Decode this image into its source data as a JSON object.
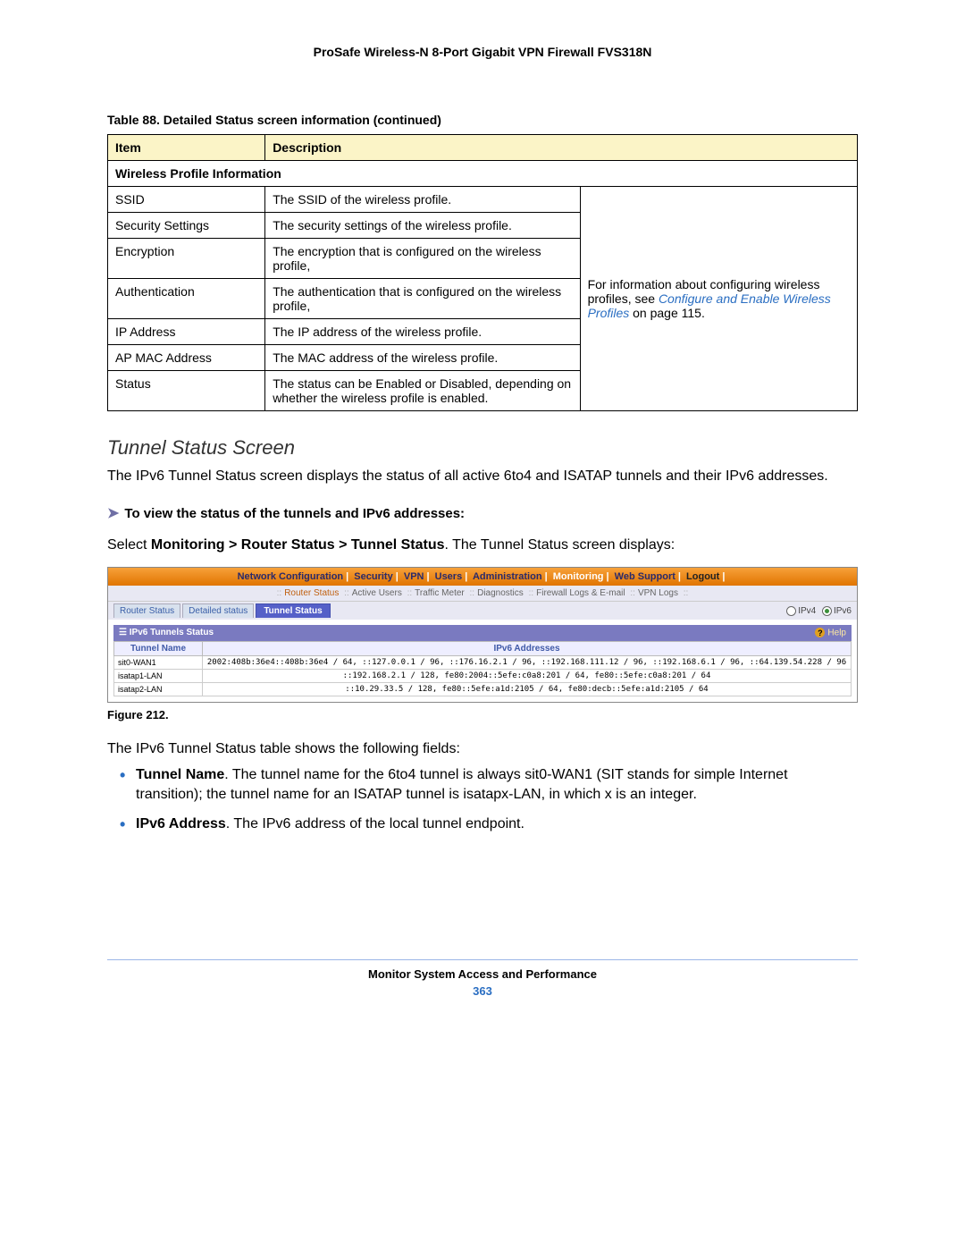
{
  "doc_title": "ProSafe Wireless-N 8-Port Gigabit VPN Firewall FVS318N",
  "table_caption": "Table 88.  Detailed Status screen information (continued)",
  "headers": {
    "item": "Item",
    "description": "Description"
  },
  "section_row": "Wireless Profile Information",
  "rows": [
    {
      "item": "SSID",
      "desc": "The SSID of the wireless profile."
    },
    {
      "item": "Security Settings",
      "desc": "The security settings of the wireless profile."
    },
    {
      "item": "Encryption",
      "desc": "The encryption that is configured on the wireless profile,."
    },
    {
      "item": "Authentication",
      "desc": "The authentication that is configured on the wireless profile,."
    },
    {
      "item": "IP Address",
      "desc": "The IP address of the wireless profile."
    },
    {
      "item": "AP MAC Address",
      "desc": "The MAC address of the wireless profile."
    },
    {
      "item": "Status",
      "desc": "The status can be Enabled or Disabled, depending on whether the wireless profile is enabled."
    }
  ],
  "side_note": {
    "pre": "For information about configuring wireless profiles, see ",
    "link": "Configure and Enable Wireless Profiles",
    "post": " on page 115."
  },
  "subhead": "Tunnel Status Screen",
  "para1": "The IPv6 Tunnel Status screen displays the status of all active 6to4 and ISATAP tunnels and their IPv6 addresses.",
  "step_head": "To view the status of the tunnels and IPv6 addresses:",
  "para2_pre": "Select ",
  "para2_bold": "Monitoring > Router Status > Tunnel Status",
  "para2_post": ". The Tunnel Status screen displays:",
  "shot": {
    "nav": [
      "Network Configuration",
      "Security",
      "VPN",
      "Users",
      "Administration",
      "Monitoring",
      "Web Support",
      "Logout"
    ],
    "nav_active_index": 5,
    "subnav": [
      "Router Status",
      "Active Users",
      "Traffic Meter",
      "Diagnostics",
      "Firewall Logs & E-mail",
      "VPN Logs"
    ],
    "subnav_hl_index": 0,
    "tabs": [
      "Router Status",
      "Detailed status",
      "Tunnel Status"
    ],
    "tab_active_index": 2,
    "ipv4": "IPv4",
    "ipv6": "IPv6",
    "panel_title": "IPv6 Tunnels Status",
    "help": "Help",
    "cols": {
      "tn": "Tunnel Name",
      "addr": "IPv6 Addresses"
    },
    "tunnels": [
      {
        "name": "sit0-WAN1",
        "addr": "2002:408b:36e4::408b:36e4 / 64, ::127.0.0.1 / 96, ::176.16.2.1 / 96, ::192.168.111.12 / 96, ::192.168.6.1 / 96, ::64.139.54.228 / 96"
      },
      {
        "name": "isatap1-LAN",
        "addr": "::192.168.2.1 / 128, fe80:2004::5efe:c0a8:201 / 64, fe80::5efe:c0a8:201 / 64"
      },
      {
        "name": "isatap2-LAN",
        "addr": "::10.29.33.5 / 128, fe80::5efe:a1d:2105 / 64, fe80:decb::5efe:a1d:2105 / 64"
      }
    ]
  },
  "figure_caption": "Figure 212.",
  "para3": "The IPv6 Tunnel Status table shows the following fields:",
  "bullets": [
    {
      "bold": "Tunnel Name",
      "rest": ". The tunnel name for the 6to4 tunnel is always sit0-WAN1 (SIT stands for simple Internet transition); the tunnel name for an ISATAP tunnel is isatapx-LAN, in which x is an integer."
    },
    {
      "bold": "IPv6 Address",
      "rest": ". The IPv6 address of the local tunnel endpoint."
    }
  ],
  "footer": {
    "title": "Monitor System Access and Performance",
    "page": "363"
  }
}
